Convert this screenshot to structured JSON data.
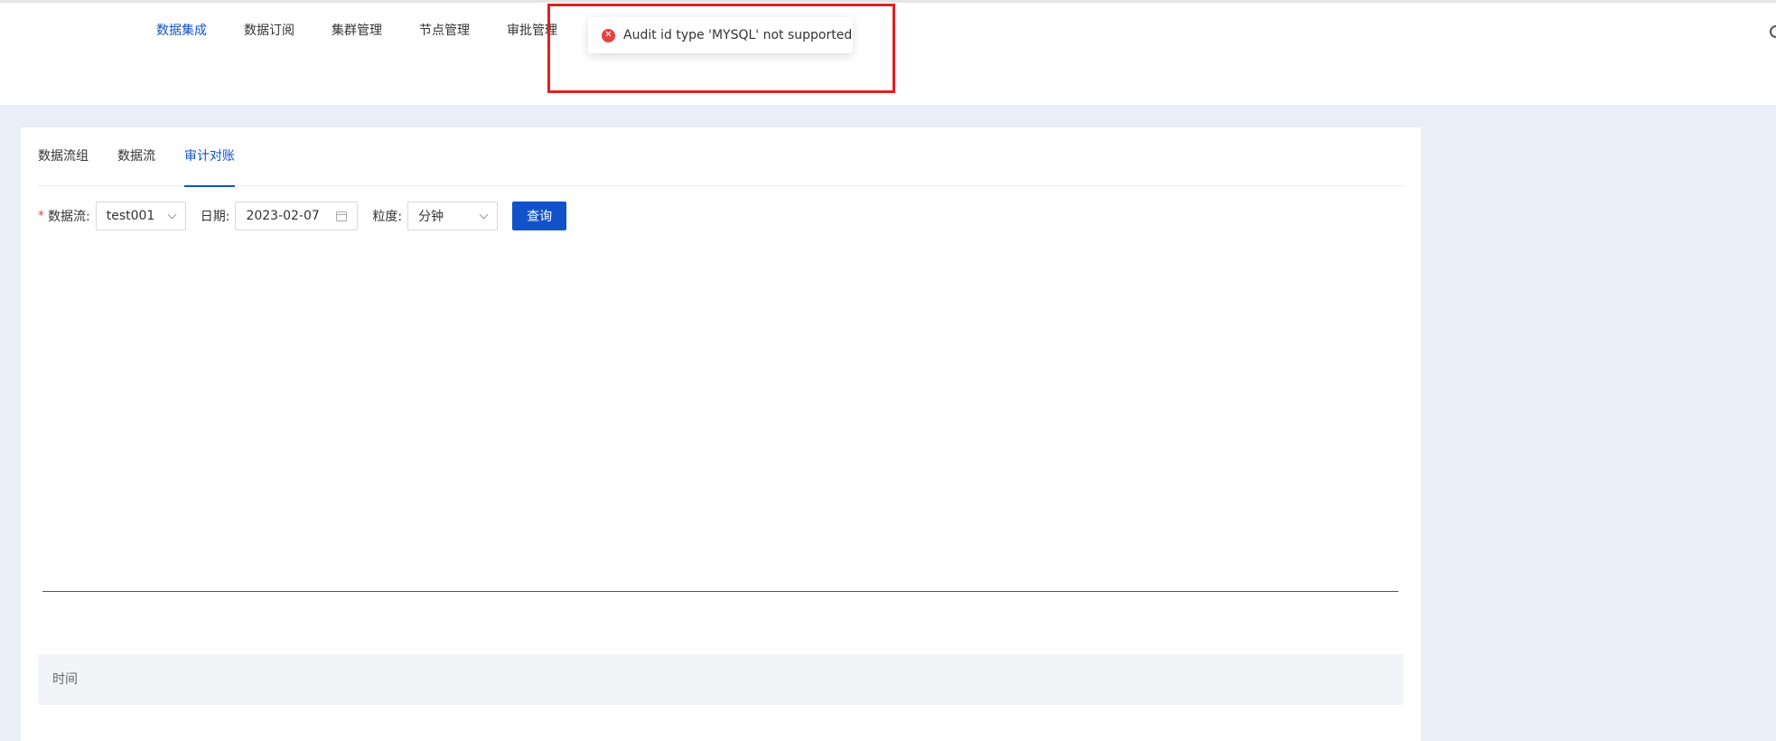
{
  "nav": {
    "items": [
      {
        "label": "数据集成",
        "active": true
      },
      {
        "label": "数据订阅",
        "active": false
      },
      {
        "label": "集群管理",
        "active": false
      },
      {
        "label": "节点管理",
        "active": false
      },
      {
        "label": "审批管理",
        "active": false
      }
    ]
  },
  "tabs": [
    {
      "label": "数据流组",
      "active": false
    },
    {
      "label": "数据流",
      "active": false
    },
    {
      "label": "审计对账",
      "active": true
    }
  ],
  "form": {
    "stream_label": "数据流:",
    "stream_value": "test001",
    "date_label": "日期:",
    "date_value": "2023-02-07",
    "granularity_label": "粒度:",
    "granularity_value": "分钟",
    "query_label": "查询"
  },
  "table": {
    "columns": [
      "时间"
    ]
  },
  "toast": {
    "message": "Audit id type 'MYSQL' not supported",
    "type": "error"
  },
  "colors": {
    "primary": "#1252c9",
    "error": "#e84040",
    "highlight": "#e02020",
    "background": "#eaeef6"
  }
}
